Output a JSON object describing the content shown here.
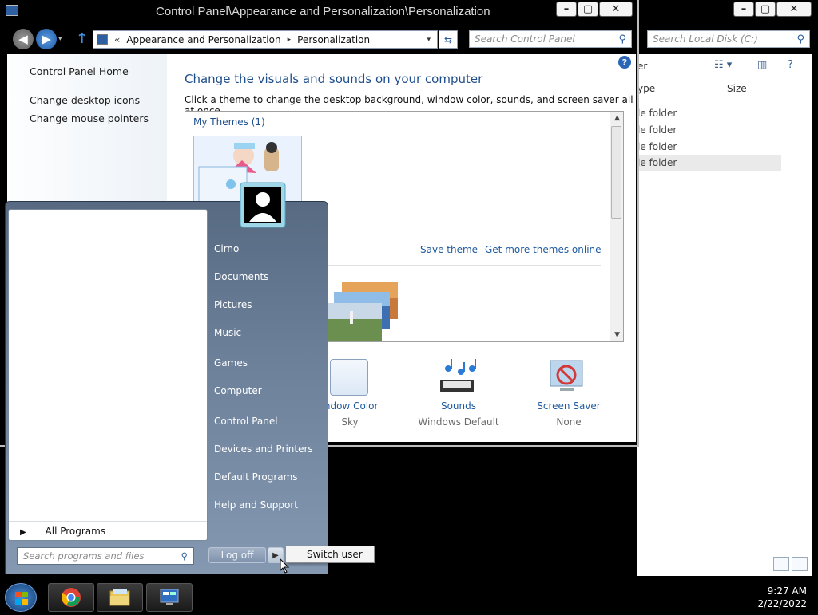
{
  "control_panel": {
    "title": "Control Panel\\Appearance and Personalization\\Personalization",
    "address": {
      "chevron": "«",
      "crumb1": "Appearance and Personalization",
      "sep": "▸",
      "crumb2": "Personalization"
    },
    "search_placeholder": "Search Control Panel",
    "sidebar": {
      "home": "Control Panel Home",
      "links": [
        "Change desktop icons",
        "Change mouse pointers"
      ]
    },
    "heading": "Change the visuals and sounds on your computer",
    "subheading": "Click a theme to change the desktop background, window color, sounds, and screen saver all at once.",
    "my_themes_label": "My Themes (1)",
    "save_theme": "Save theme",
    "get_more_themes": "Get more themes online",
    "bottom": {
      "window_color": {
        "label": "indow Color",
        "value": "Sky"
      },
      "sounds": {
        "label": "Sounds",
        "value": "Windows Default"
      },
      "screen_saver": {
        "label": "Screen Saver",
        "value": "None"
      }
    }
  },
  "explorer": {
    "search_placeholder": "Search Local Disk (C:)",
    "toolbar_label": "er",
    "col_type": "ype",
    "col_size": "Size",
    "rows": [
      "le folder",
      "le folder",
      "le folder",
      "le folder"
    ]
  },
  "start_menu": {
    "right_items": [
      "Cirno",
      "Documents",
      "Pictures",
      "Music",
      "Games",
      "Computer",
      "Control Panel",
      "Devices and Printers",
      "Default Programs",
      "Help and Support"
    ],
    "all_programs": "All Programs",
    "search_placeholder": "Search programs and files",
    "log_off": "Log off",
    "switch_user": "Switch user"
  },
  "taskbar": {
    "time": "9:27 AM",
    "date": "2/22/2022"
  }
}
